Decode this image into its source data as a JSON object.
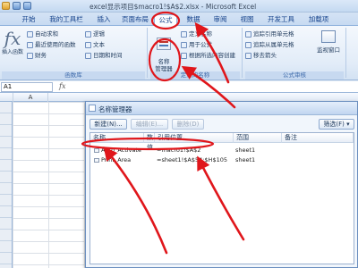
{
  "window": {
    "title": "excel显示项目$macro1!$A$2.xlsx - Microsoft Excel"
  },
  "ribbon_tabs": [
    {
      "label": "开始"
    },
    {
      "label": "我的工具栏"
    },
    {
      "label": "插入"
    },
    {
      "label": "页面布局"
    },
    {
      "label": "公式",
      "active": true
    },
    {
      "label": "数据"
    },
    {
      "label": "审阅"
    },
    {
      "label": "视图"
    },
    {
      "label": "开发工具"
    },
    {
      "label": "加载项"
    }
  ],
  "ribbon": {
    "function_library": {
      "insert_function": "插入函数",
      "autosum": "自动求和",
      "recent": "最近使用的函数",
      "financial": "财务",
      "logical": "逻辑",
      "text": "文本",
      "datetime": "日期和时间",
      "label": "函数库"
    },
    "defined_names": {
      "name_manager": "名称\n管理器",
      "define_name": "定义名称",
      "use_in_formula": "用于公式",
      "create_from_selection": "根据所选内容创建",
      "label": "定义的名称"
    },
    "formula_auditing": {
      "trace_precedents": "追踪引用单元格",
      "trace_dependents": "追踪从属单元格",
      "remove_arrows": "移去箭头",
      "watch_window": "监视窗口",
      "label": "公式审核"
    }
  },
  "formula_bar": {
    "name_box": "A1"
  },
  "sheet": {
    "column_a": "A"
  },
  "name_manager": {
    "title": "名称管理器",
    "buttons": {
      "new": "新建(N)...",
      "edit": "编辑(E)...",
      "delete": "删除(D)",
      "filter": "筛选(F)"
    },
    "columns": [
      "名称",
      "数值",
      "引用位置",
      "范围",
      "备注"
    ],
    "rows": [
      {
        "name": "Auto_Activate",
        "value": "",
        "refers_to": "=macro1!$A$2",
        "scope": "sheet1",
        "comment": ""
      },
      {
        "name": "Print_Area",
        "value": "",
        "refers_to": "=sheet1!$A$54:$H$105",
        "scope": "sheet1",
        "comment": ""
      }
    ]
  },
  "colors": {
    "annotation": "#e0161b",
    "ribbon_bg": "#dfe9f5"
  }
}
